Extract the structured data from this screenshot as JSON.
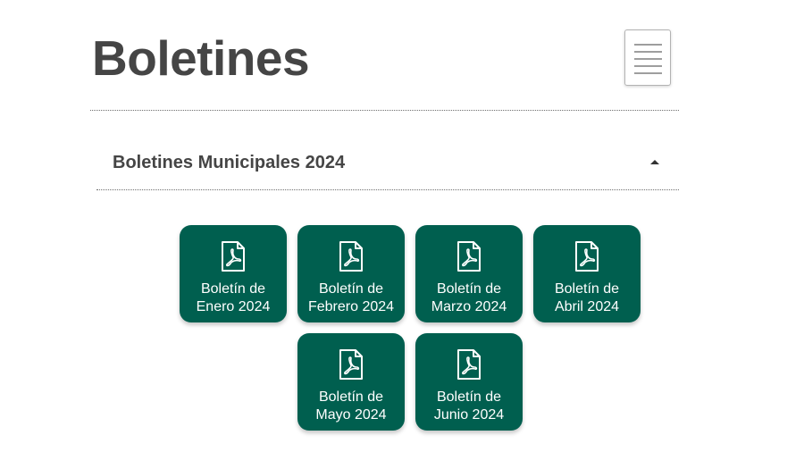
{
  "page": {
    "title": "Boletines"
  },
  "menu": {
    "icon": "hamburger-menu-icon"
  },
  "accordion": {
    "title": "Boletines Municipales 2024",
    "caret_icon": "caret-up-icon",
    "expanded": true
  },
  "tiles": [
    {
      "line1": "Boletín de",
      "line2": "Enero 2024",
      "icon": "pdf-file-icon"
    },
    {
      "line1": "Boletín de",
      "line2": "Febrero 2024",
      "icon": "pdf-file-icon"
    },
    {
      "line1": "Boletín de",
      "line2": "Marzo 2024",
      "icon": "pdf-file-icon"
    },
    {
      "line1": "Boletín de",
      "line2": "Abril 2024",
      "icon": "pdf-file-icon"
    },
    {
      "line1": "Boletín de",
      "line2": "Mayo 2024",
      "icon": "pdf-file-icon"
    },
    {
      "line1": "Boletín de",
      "line2": "Junio 2024",
      "icon": "pdf-file-icon"
    }
  ],
  "colors": {
    "tile_background": "#005f4f",
    "tile_text": "#ffffff",
    "heading_text": "#454545"
  }
}
